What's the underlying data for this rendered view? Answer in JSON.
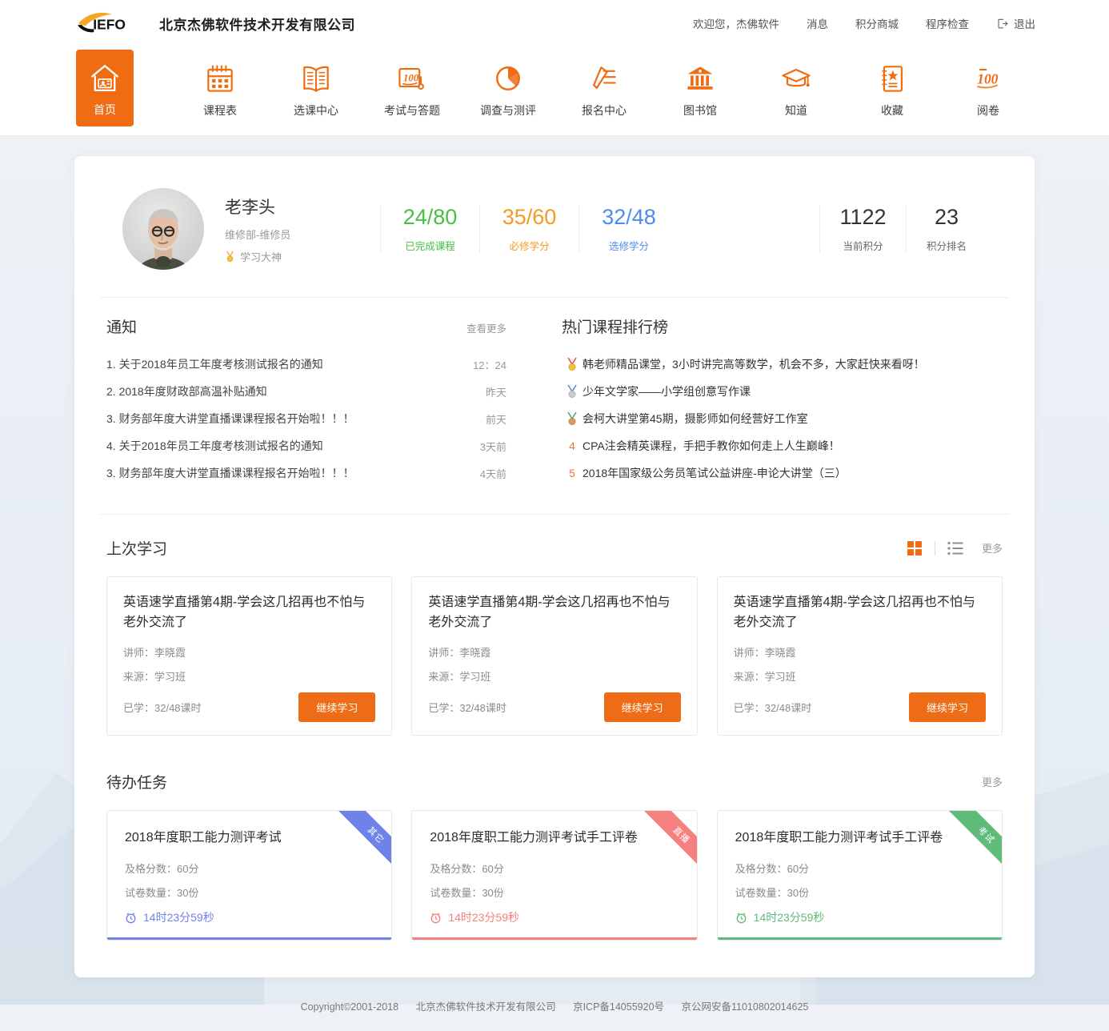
{
  "header": {
    "brand_name": "北京杰佛软件技术开发有限公司",
    "logo_text": "JIEFO",
    "util_nav": [
      {
        "label": "欢迎您，杰佛软件",
        "name": "welcome-user"
      },
      {
        "label": "消息",
        "name": "messages"
      },
      {
        "label": "积分商城",
        "name": "points-mall"
      },
      {
        "label": "程序检查",
        "name": "program-check"
      }
    ],
    "logout_label": "退出",
    "main_nav": [
      {
        "label": "首页",
        "icon": "home-icon",
        "active": true
      },
      {
        "label": "课程表",
        "icon": "calendar-icon",
        "active": false
      },
      {
        "label": "选课中心",
        "icon": "book-open-icon",
        "active": false
      },
      {
        "label": "考试与答题",
        "icon": "exam-100-icon",
        "active": false
      },
      {
        "label": "调查与测评",
        "icon": "pie-chart-icon",
        "active": false
      },
      {
        "label": "报名中心",
        "icon": "pencil-list-icon",
        "active": false
      },
      {
        "label": "图书馆",
        "icon": "library-icon",
        "active": false
      },
      {
        "label": "知道",
        "icon": "graduation-cap-icon",
        "active": false
      },
      {
        "label": "收藏",
        "icon": "star-book-icon",
        "active": false
      },
      {
        "label": "阅卷",
        "icon": "score-100-icon",
        "active": false
      }
    ]
  },
  "profile": {
    "name": "老李头",
    "department": "维修部-维修员",
    "title": "学习大神",
    "stats": [
      {
        "value": "24/80",
        "label": "已完成课程",
        "color": "#44c240"
      },
      {
        "value": "35/60",
        "label": "必修学分",
        "color": "#f59a23"
      },
      {
        "value": "32/48",
        "label": "选修学分",
        "color": "#4a8cf0"
      }
    ],
    "points": [
      {
        "value": "1122",
        "label": "当前积分"
      },
      {
        "value": "23",
        "label": "积分排名"
      }
    ]
  },
  "notices": {
    "title": "通知",
    "more_label": "查看更多",
    "items": [
      {
        "text": "1. 关于2018年员工年度考核测试报名的通知",
        "time": "12：24"
      },
      {
        "text": "2. 2018年度财政部高温补贴通知",
        "time": "昨天"
      },
      {
        "text": "3. 财务部年度大讲堂直播课课程报名开始啦！！！",
        "time": "前天"
      },
      {
        "text": "4. 关于2018年员工年度考核测试报名的通知",
        "time": "3天前"
      },
      {
        "text": "3. 财务部年度大讲堂直播课课程报名开始啦！！！",
        "time": "4天前"
      }
    ]
  },
  "ranking": {
    "title": "热门课程排行榜",
    "items": [
      {
        "rank": "1",
        "medal": "gold",
        "text": "韩老师精品课堂，3小时讲完高等数学，机会不多，大家赶快来看呀！"
      },
      {
        "rank": "2",
        "medal": "silver",
        "text": "少年文学家——小学组创意写作课"
      },
      {
        "rank": "3",
        "medal": "bronze",
        "text": "会柯大讲堂第45期，摄影师如何经营好工作室"
      },
      {
        "rank": "4",
        "medal": "none",
        "text": "CPA注会精英课程，手把手教你如何走上人生巅峰！"
      },
      {
        "rank": "5",
        "medal": "none",
        "text": "2018年国家级公务员笔试公益讲座-申论大讲堂（三）"
      }
    ]
  },
  "last_study": {
    "title": "上次学习",
    "more_label": "更多",
    "view_grid_icon": "grid-view-icon",
    "view_list_icon": "list-view-icon",
    "cards": [
      {
        "title": "英语速学直播第4期-学会这几招再也不怕与老外交流了",
        "teacher": "讲师：李晓霞",
        "source": "来源：学习班",
        "progress": "已学：32/48课时",
        "button": "继续学习"
      },
      {
        "title": "英语速学直播第4期-学会这几招再也不怕与老外交流了",
        "teacher": "讲师：李晓霞",
        "source": "来源：学习班",
        "progress": "已学：32/48课时",
        "button": "继续学习"
      },
      {
        "title": "英语速学直播第4期-学会这几招再也不怕与老外交流了",
        "teacher": "讲师：李晓霞",
        "source": "来源：学习班",
        "progress": "已学：32/48课时",
        "button": "继续学习"
      }
    ]
  },
  "todo": {
    "title": "待办任务",
    "more_label": "更多",
    "cards": [
      {
        "title": "2018年度职工能力测评考试",
        "pass_score": "及格分数：60分",
        "paper_count": "试卷数量：30份",
        "countdown": "14时23分59秒",
        "ribbon": "其它",
        "accent": "#6f82e8"
      },
      {
        "title": "2018年度职工能力测评考试手工评卷",
        "pass_score": "及格分数：60分",
        "paper_count": "试卷数量：30份",
        "countdown": "14时23分59秒",
        "ribbon": "直播",
        "accent": "#f4807f"
      },
      {
        "title": "2018年度职工能力测评考试手工评卷",
        "pass_score": "及格分数：60分",
        "paper_count": "试卷数量：30份",
        "countdown": "14时23分59秒",
        "ribbon": "考试",
        "accent": "#5fbb7a"
      }
    ]
  },
  "footer": {
    "copyright": "Copyright©2001-2018",
    "company": "北京杰佛软件技术开发有限公司",
    "icp": "京ICP备14055920号",
    "police": "京公网安备11010802014625"
  },
  "theme": {
    "accent": "#ef6c12"
  }
}
